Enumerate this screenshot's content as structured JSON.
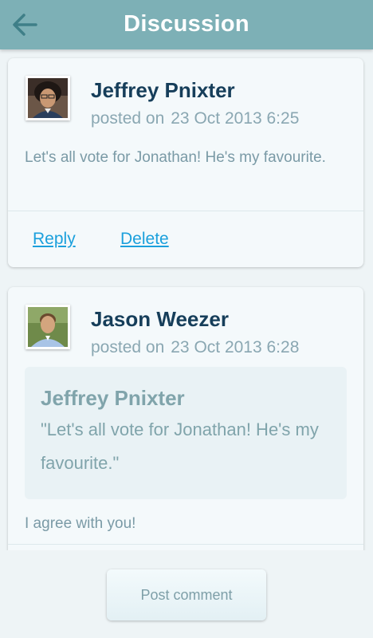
{
  "header": {
    "title": "Discussion",
    "back_icon": "arrow-left-icon"
  },
  "colors": {
    "header_bg": "#7db0b6",
    "name_color": "#163e5a",
    "link_color": "#1ba0dc",
    "meta_color": "#8aa7b2"
  },
  "posts": [
    {
      "author": "Jeffrey Pnixter",
      "posted_label": "posted on",
      "date": "23 Oct 2013 6:25",
      "text": "Let's all vote for Jonathan! He's my favourite.",
      "actions": {
        "reply": "Reply",
        "delete": "Delete"
      }
    },
    {
      "author": "Jason Weezer",
      "posted_label": "posted on",
      "date": "23 Oct 2013 6:28",
      "quote": {
        "author": "Jeffrey Pnixter",
        "text": "\"Let's all vote for Jonathan! He's my favourite.\""
      },
      "text": "I agree with you!"
    }
  ],
  "footer": {
    "post_button": "Post comment"
  }
}
